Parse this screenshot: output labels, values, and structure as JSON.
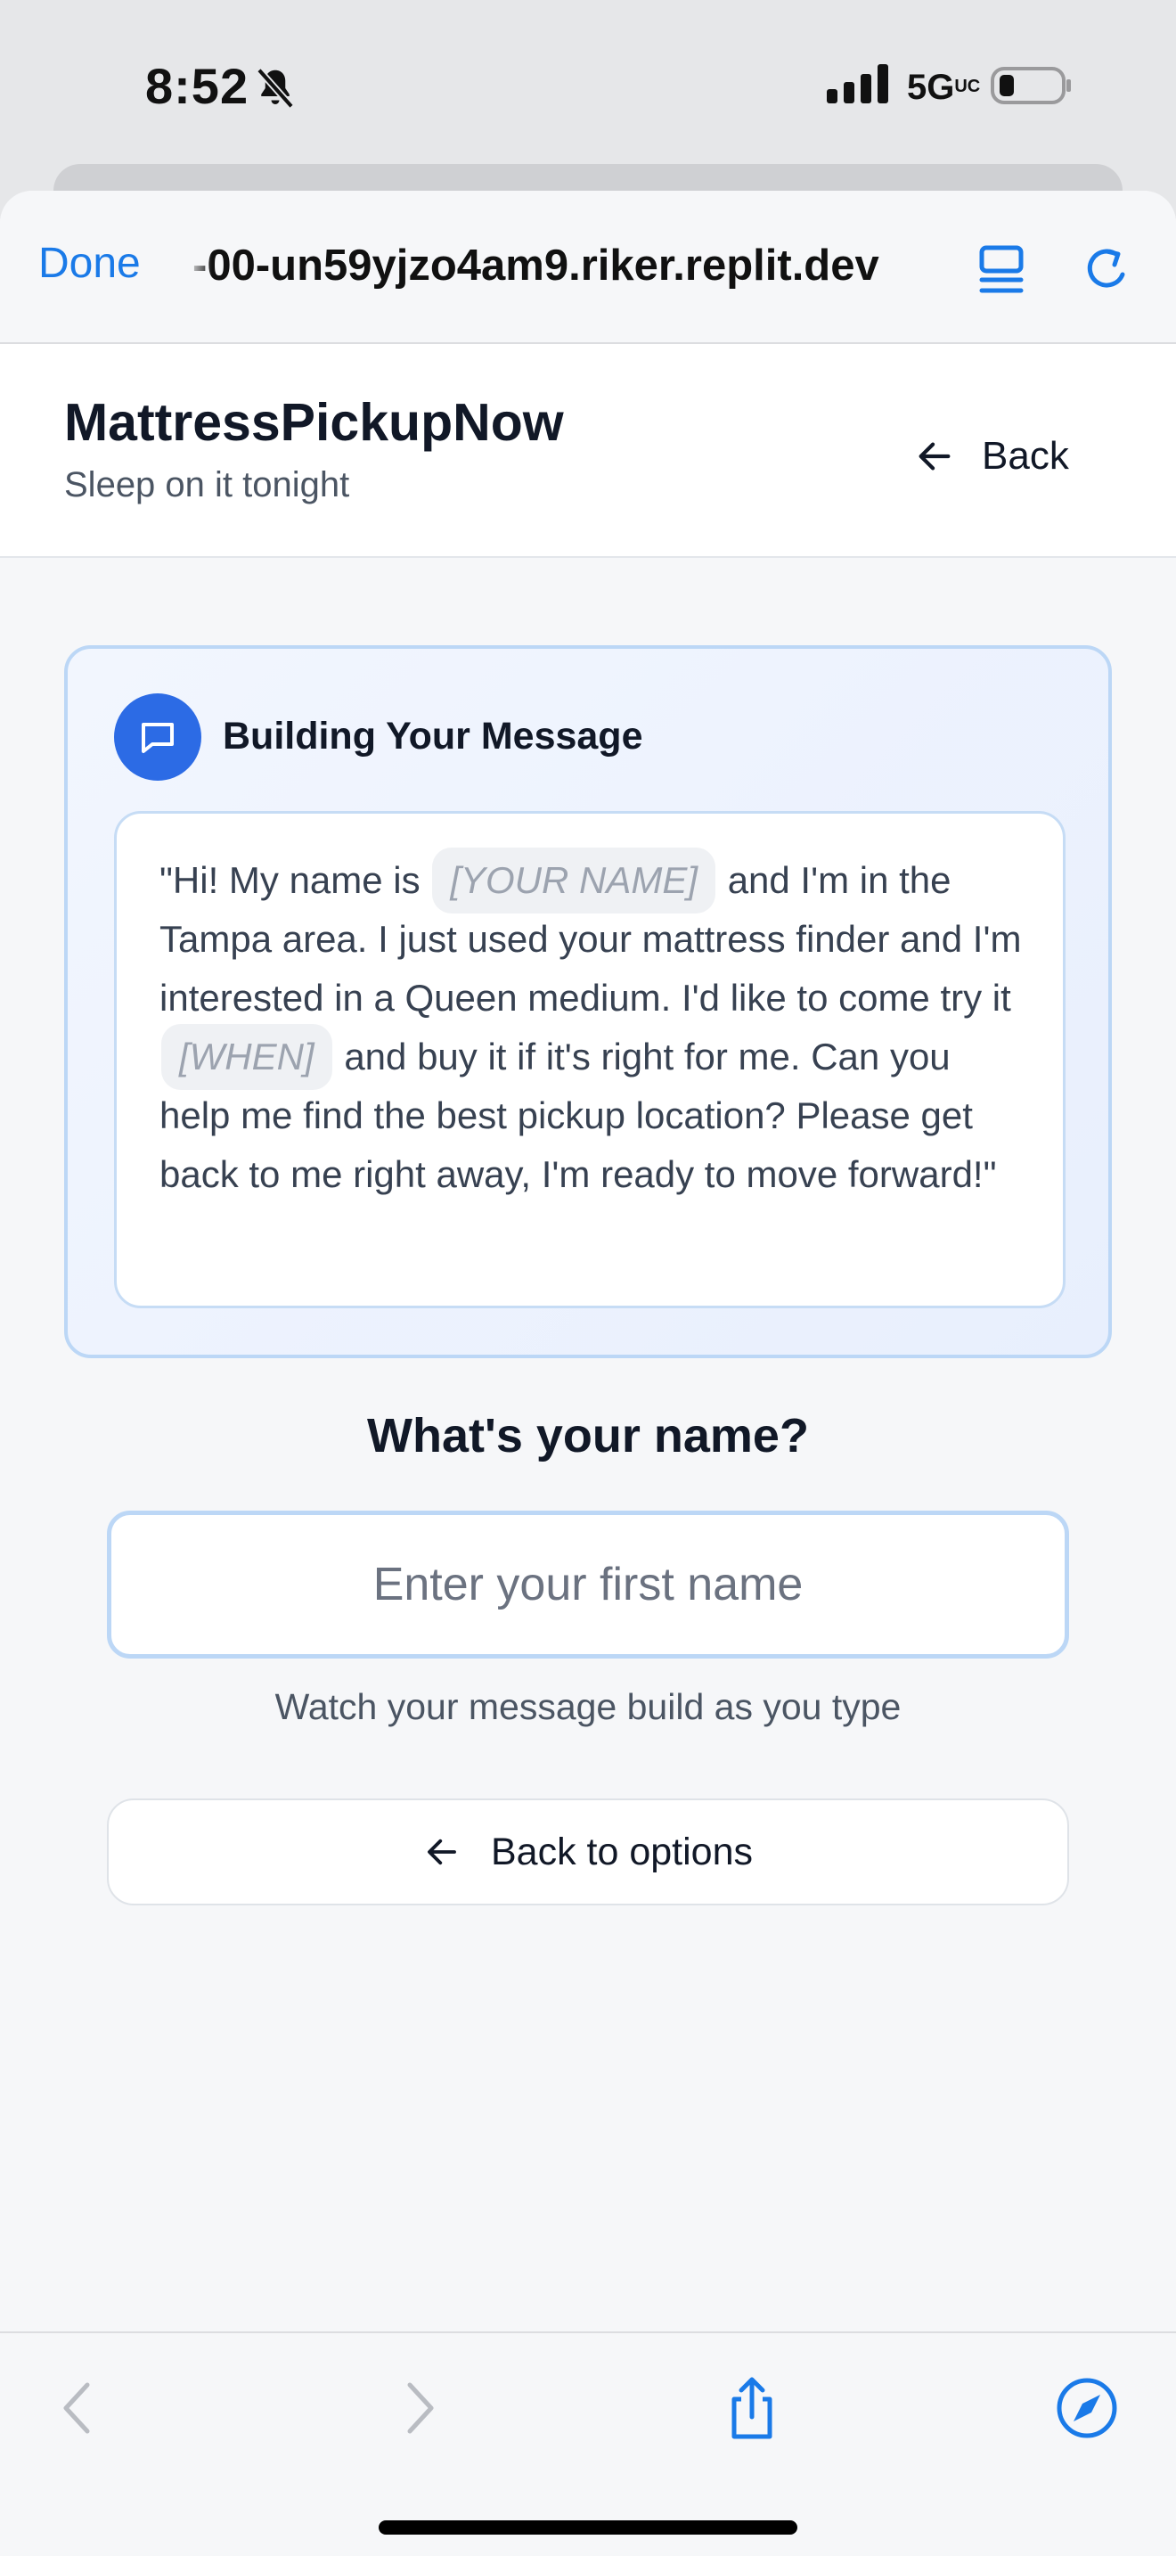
{
  "status_bar": {
    "time": "8:52",
    "network": "5G",
    "network_suffix": "UC",
    "icons": [
      "bell-slash-icon",
      "signal-bars-icon",
      "battery-icon"
    ]
  },
  "browser": {
    "done_label": "Done",
    "url": "-00-un59yjzo4am9.riker.replit.dev",
    "accent_color": "#1a7ae8",
    "icons": [
      "tabs-icon",
      "reload-icon"
    ]
  },
  "header": {
    "title": "MattressPickupNow",
    "tagline": "Sleep on it tonight",
    "back_label": "Back"
  },
  "message_card": {
    "title": "Building Your Message",
    "message": {
      "part1": "\"Hi! My name is",
      "name_placeholder": "[YOUR NAME]",
      "part2": "and I'm in the Tampa area. I just used your mattress finder and I'm interested in a Queen medium. I'd like to come try it",
      "when_placeholder": "[WHEN]",
      "part3": "and buy it if it's right for me. Can you help me find the best pickup location? Please get back to me right away, I'm ready to move forward!\""
    },
    "badge_color": "#2c6be5"
  },
  "form": {
    "question": "What's your name?",
    "name_placeholder": "Enter your first name",
    "name_value": "",
    "hint": "Watch your message build as you type",
    "back_to_options_label": "Back to options"
  },
  "toolbar": {
    "icons": [
      "back-arrow-icon",
      "forward-arrow-icon",
      "share-icon",
      "compass-icon"
    ]
  }
}
